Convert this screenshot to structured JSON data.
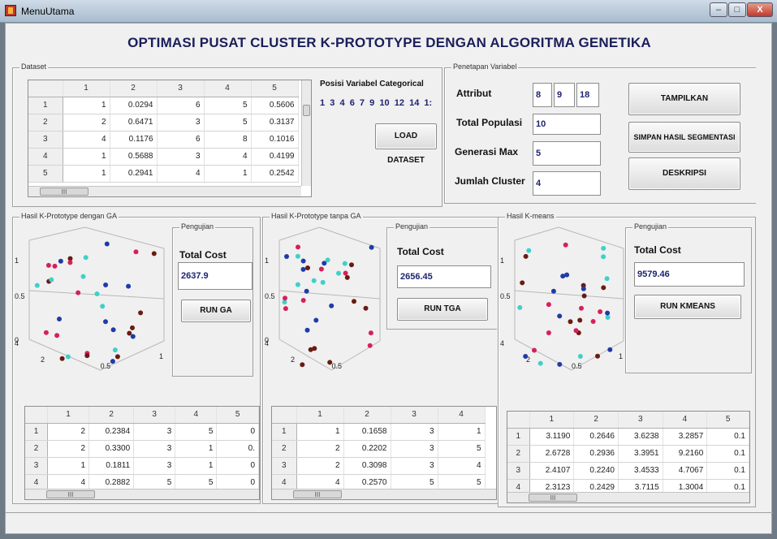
{
  "window": {
    "title": "MenuUtama",
    "buttons": [
      "–",
      "□",
      "X"
    ]
  },
  "main_title": "OPTIMASI PUSAT CLUSTER K-PROTOTYPE DENGAN ALGORITMA GENETIKA",
  "dataset": {
    "label": "Dataset",
    "columns": [
      "1",
      "2",
      "3",
      "4",
      "5"
    ],
    "rows": [
      {
        "h": "1",
        "c": [
          "1",
          "0.0294",
          "6",
          "5",
          "0.5606"
        ]
      },
      {
        "h": "2",
        "c": [
          "2",
          "0.6471",
          "3",
          "5",
          "0.3137"
        ]
      },
      {
        "h": "3",
        "c": [
          "4",
          "0.1176",
          "6",
          "8",
          "0.1016"
        ]
      },
      {
        "h": "4",
        "c": [
          "1",
          "0.5688",
          "3",
          "4",
          "0.4199"
        ]
      },
      {
        "h": "5",
        "c": [
          "1",
          "0.2941",
          "4",
          "1",
          "0.2542"
        ]
      }
    ],
    "scroll_thumb": "III"
  },
  "posisi": {
    "label": "Posisi Variabel Categorical",
    "values": "1  3  4  6  7  9  10  12  14  1:"
  },
  "load_button": "LOAD DATASET",
  "penetapan": {
    "label": "Penetapan Variabel",
    "attribut_label": "Attribut",
    "attribut_values": [
      "8",
      "9",
      "18"
    ],
    "total_populasi_label": "Total Populasi",
    "total_populasi": "10",
    "generasi_label": "Generasi Max",
    "generasi": "5",
    "jumlah_label": "Jumlah Cluster",
    "jumlah": "4"
  },
  "buttons": {
    "tampilkan": "TAMPILKAN",
    "simpan": "SIMPAN HASIL SEGMENTASI",
    "deskripsi": "DESKRIPSI"
  },
  "panels": [
    {
      "label": "Hasil K-Prototype dengan GA",
      "pengujian_label": "Pengujian",
      "total_cost_label": "Total Cost",
      "total_cost": "2637.9",
      "run_label": "RUN GA",
      "axis": {
        "z": [
          "1",
          "0.5",
          "0"
        ],
        "x": [
          "0.5",
          "1"
        ],
        "y": [
          "4",
          "2"
        ]
      },
      "table": {
        "columns": [
          "1",
          "2",
          "3",
          "4",
          "5"
        ],
        "rows": [
          {
            "h": "1",
            "c": [
              "2",
              "0.2384",
              "3",
              "5",
              "0"
            ]
          },
          {
            "h": "2",
            "c": [
              "2",
              "0.3300",
              "3",
              "1",
              "0."
            ]
          },
          {
            "h": "3",
            "c": [
              "1",
              "0.1811",
              "3",
              "1",
              "0"
            ]
          },
          {
            "h": "4",
            "c": [
              "4",
              "0.2882",
              "5",
              "5",
              "0"
            ]
          }
        ],
        "scroll_thumb": "III"
      }
    },
    {
      "label": "Hasil K-Prototype tanpa GA",
      "pengujian_label": "Pengujian",
      "total_cost_label": "Total Cost",
      "total_cost": "2656.45",
      "run_label": "RUN TGA",
      "axis": {
        "z": [
          "1",
          "0.5",
          "0"
        ],
        "x": [
          "0.5"
        ],
        "y": [
          "4",
          "2"
        ]
      },
      "table": {
        "columns": [
          "1",
          "2",
          "3",
          "4"
        ],
        "rows": [
          {
            "h": "1",
            "c": [
              "1",
              "0.1658",
              "3",
              "1"
            ]
          },
          {
            "h": "2",
            "c": [
              "2",
              "0.2202",
              "3",
              "5"
            ]
          },
          {
            "h": "3",
            "c": [
              "2",
              "0.3098",
              "3",
              "4"
            ]
          },
          {
            "h": "4",
            "c": [
              "4",
              "0.2570",
              "5",
              "5"
            ]
          }
        ],
        "scroll_thumb": "III"
      }
    },
    {
      "label": "Hasil K-means",
      "pengujian_label": "Pengujian",
      "total_cost_label": "Total Cost",
      "total_cost": "9579.46",
      "run_label": "RUN KMEANS",
      "axis": {
        "z": [
          "1",
          "0.5"
        ],
        "x": [
          "0.5",
          "1"
        ],
        "y": [
          "4",
          "2"
        ]
      },
      "table": {
        "columns": [
          "1",
          "2",
          "3",
          "4",
          "5"
        ],
        "rows": [
          {
            "h": "1",
            "c": [
              "3.1190",
              "0.2646",
              "3.6238",
              "3.2857",
              "0.1"
            ]
          },
          {
            "h": "2",
            "c": [
              "2.6728",
              "0.2936",
              "3.3951",
              "9.2160",
              "0.1"
            ]
          },
          {
            "h": "3",
            "c": [
              "2.4107",
              "0.2240",
              "3.4533",
              "4.7067",
              "0.1"
            ]
          },
          {
            "h": "4",
            "c": [
              "2.3123",
              "0.2429",
              "3.7115",
              "1.3004",
              "0.1"
            ]
          }
        ],
        "scroll_thumb": "III"
      }
    }
  ],
  "colors": {
    "c1": "#1f3ba8",
    "c2": "#6a1b12",
    "c3": "#d6205a",
    "c4": "#3fd0c8",
    "title": "#1a1e5a",
    "value": "#1d2470"
  }
}
